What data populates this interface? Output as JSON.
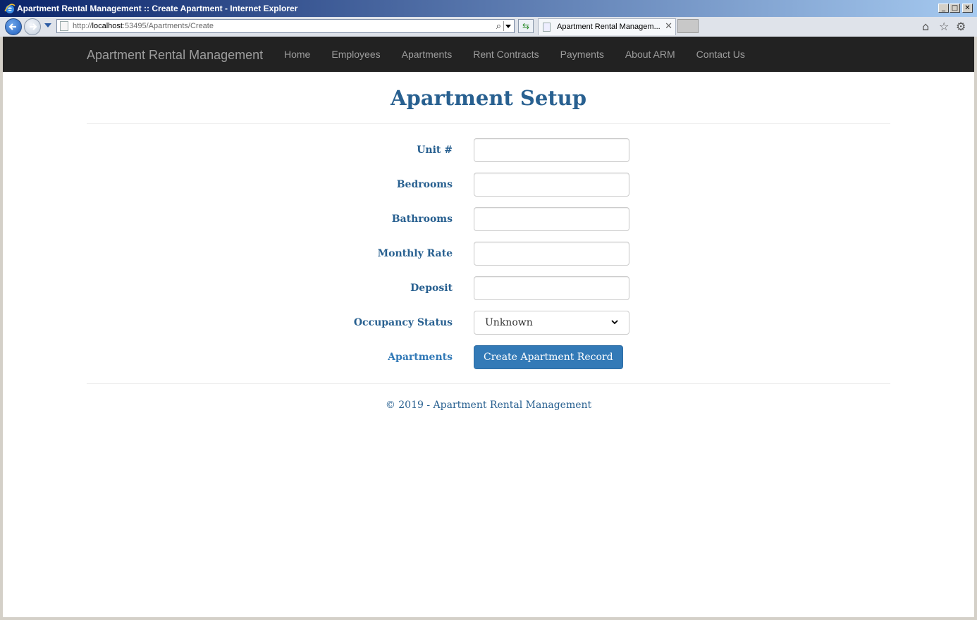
{
  "window": {
    "title": "Apartment Rental Management :: Create Apartment - Internet Explorer",
    "minimize": "_",
    "maximize": "□",
    "close": "✕"
  },
  "browser": {
    "url_prefix": "http://",
    "url_host": "localhost",
    "url_rest": ":53495/Apartments/Create",
    "tab_title": "Apartment Rental Managem...",
    "icons": [
      "back-icon",
      "forward-icon",
      "search-icon",
      "refresh-icon",
      "home-icon",
      "favorites-star-icon",
      "settings-gear-icon"
    ]
  },
  "navbar": {
    "brand": "Apartment Rental Management",
    "links": [
      "Home",
      "Employees",
      "Apartments",
      "Rent Contracts",
      "Payments",
      "About ARM",
      "Contact Us"
    ]
  },
  "page": {
    "title": "Apartment Setup"
  },
  "form": {
    "unit_label": "Unit #",
    "unit_value": "",
    "bedrooms_label": "Bedrooms",
    "bedrooms_value": "",
    "bathrooms_label": "Bathrooms",
    "bathrooms_value": "",
    "monthly_rate_label": "Monthly Rate",
    "monthly_rate_value": "",
    "deposit_label": "Deposit",
    "deposit_value": "",
    "occupancy_label": "Occupancy Status",
    "occupancy_value": "Unknown",
    "apartments_link": "Apartments",
    "submit_label": "Create Apartment Record"
  },
  "footer": {
    "text": "© 2019 - Apartment Rental Management"
  },
  "colors": {
    "navbar_bg": "#222222",
    "navbar_text": "#9d9d9d",
    "heading": "#286090",
    "button_bg": "#337ab7"
  }
}
